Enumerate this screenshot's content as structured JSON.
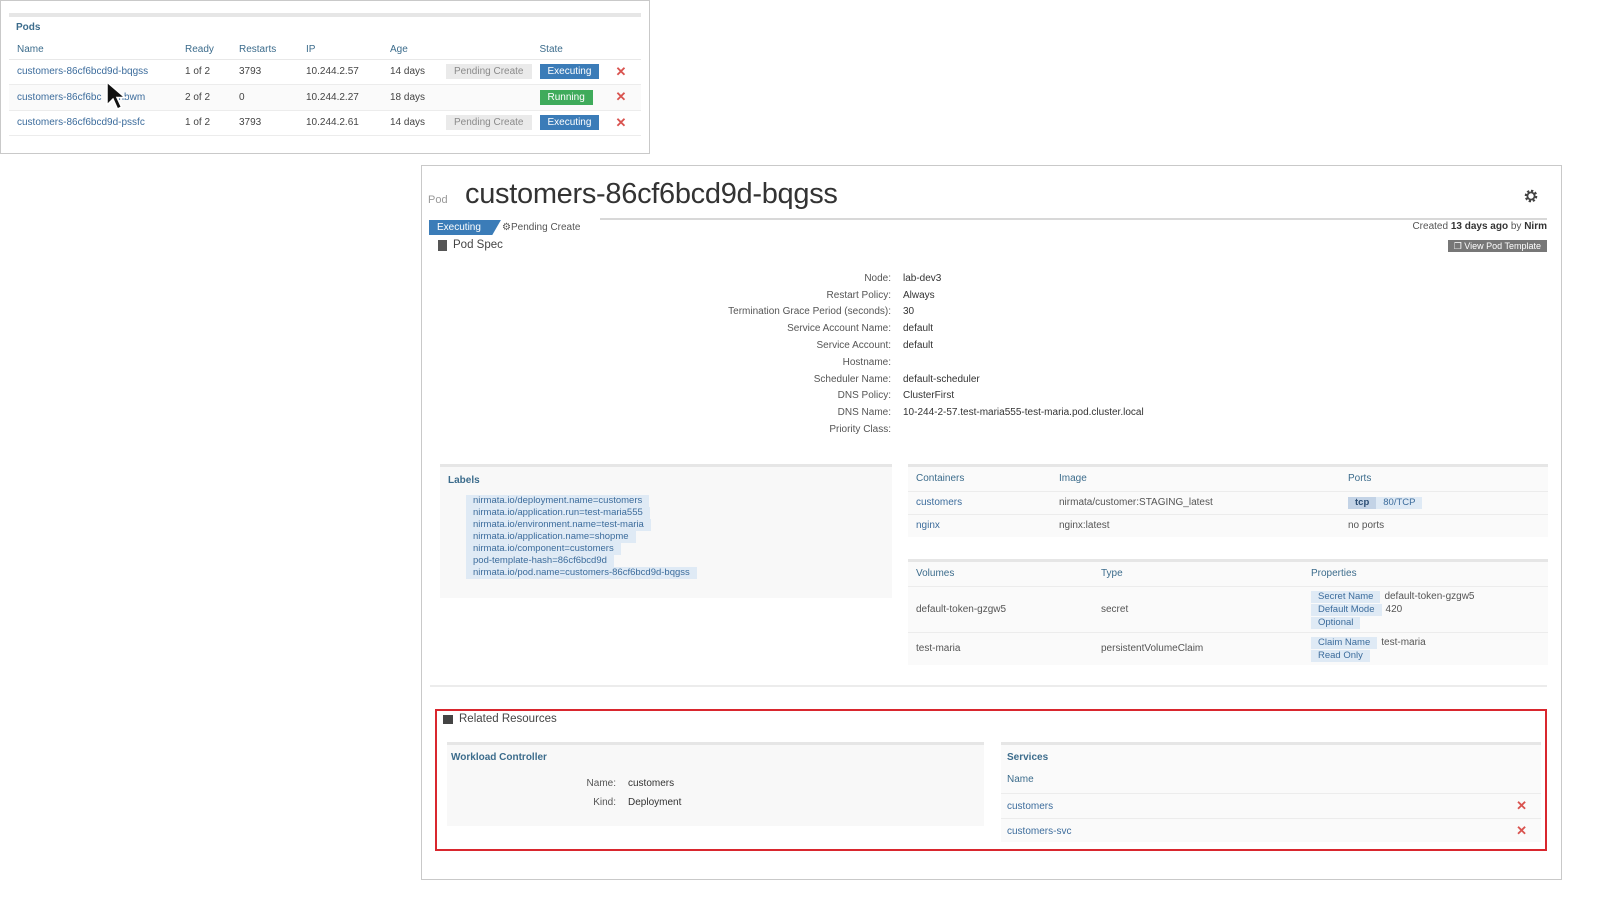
{
  "pods": {
    "title": "Pods",
    "columns": [
      "Name",
      "Ready",
      "Restarts",
      "IP",
      "Age",
      "",
      "State",
      ""
    ],
    "rows": [
      {
        "name": "customers-86cf6bcd9d-bqgss",
        "ready": "1 of 2",
        "restarts": "3793",
        "ip": "10.244.2.57",
        "age": "14 days",
        "pending": "Pending Create",
        "state": "Executing"
      },
      {
        "name": "customers-86cf6bc",
        "name_tail": "nbwm",
        "ready": "2 of 2",
        "restarts": "0",
        "ip": "10.244.2.27",
        "age": "18 days",
        "pending": "",
        "state": "Running"
      },
      {
        "name": "customers-86cf6bcd9d-pssfc",
        "ready": "1 of 2",
        "restarts": "3793",
        "ip": "10.244.2.61",
        "age": "14 days",
        "pending": "Pending Create",
        "state": "Executing"
      }
    ],
    "delete_glyph": "✕"
  },
  "detail": {
    "kind": "Pod",
    "title": "customers-86cf6bcd9d-bqgss",
    "status": "Executing",
    "sub_status": "Pending Create",
    "created_prefix": "Created",
    "created_age": "13 days ago",
    "created_by_prefix": "by",
    "created_by": "Nirm",
    "pod_spec_label": "Pod Spec",
    "view_template_label": "View Pod Template",
    "spec": [
      {
        "key": "Node:",
        "value": "lab-dev3"
      },
      {
        "key": "Restart Policy:",
        "value": "Always"
      },
      {
        "key": "Termination Grace Period (seconds):",
        "value": "30"
      },
      {
        "key": "Service Account Name:",
        "value": "default"
      },
      {
        "key": "Service Account:",
        "value": "default"
      },
      {
        "key": "Hostname:",
        "value": ""
      },
      {
        "key": "Scheduler Name:",
        "value": "default-scheduler"
      },
      {
        "key": "DNS Policy:",
        "value": "ClusterFirst"
      },
      {
        "key": "DNS Name:",
        "value": "10-244-2-57.test-maria555-test-maria.pod.cluster.local"
      },
      {
        "key": "Priority Class:",
        "value": ""
      }
    ],
    "labels_title": "Labels",
    "labels": [
      "nirmata.io/deployment.name=customers",
      "nirmata.io/application.run=test-maria555",
      "nirmata.io/environment.name=test-maria",
      "nirmata.io/application.name=shopme",
      "nirmata.io/component=customers",
      "pod-template-hash=86cf6bcd9d",
      "nirmata.io/pod.name=customers-86cf6bcd9d-bqgss"
    ],
    "containers": {
      "headers": [
        "Containers",
        "Image",
        "Ports"
      ],
      "rows": [
        {
          "name": "customers",
          "image": "nirmata/customer:STAGING_latest",
          "port_proto": "tcp",
          "port": "80/TCP"
        },
        {
          "name": "nginx",
          "image": "nginx:latest",
          "ports_text": "no ports"
        }
      ]
    },
    "volumes": {
      "headers": [
        "Volumes",
        "Type",
        "Properties"
      ],
      "rows": [
        {
          "name": "default-token-gzgw5",
          "type": "secret",
          "props": [
            {
              "k": "Secret Name",
              "v": "default-token-gzgw5"
            },
            {
              "k": "Default Mode",
              "v": "420"
            },
            {
              "k": "Optional",
              "v": ""
            }
          ]
        },
        {
          "name": "test-maria",
          "type": "persistentVolumeClaim",
          "props": [
            {
              "k": "Claim Name",
              "v": "test-maria"
            },
            {
              "k": "Read Only",
              "v": ""
            }
          ]
        }
      ]
    },
    "related": {
      "title": "Related Resources",
      "workload": {
        "title": "Workload Controller",
        "name_key": "Name:",
        "name_val": "customers",
        "kind_key": "Kind:",
        "kind_val": "Deployment"
      },
      "services": {
        "title": "Services",
        "column": "Name",
        "rows": [
          "customers",
          "customers-svc"
        ]
      }
    }
  }
}
